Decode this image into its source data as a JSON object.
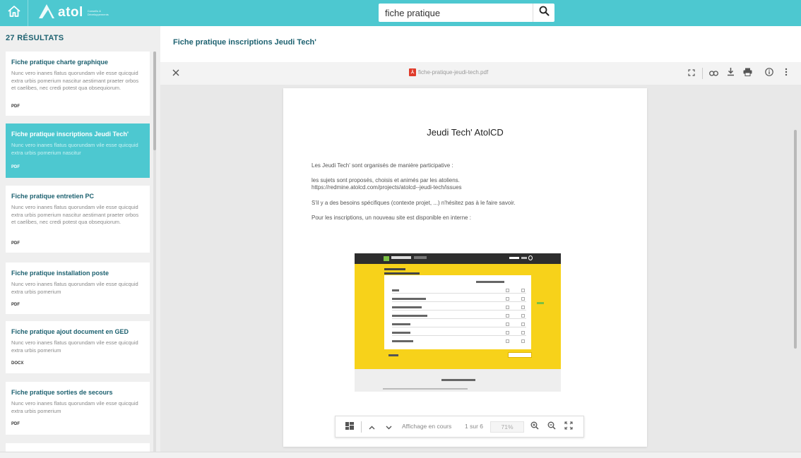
{
  "header": {
    "logo_word": "atol",
    "logo_tagline": "Conseils & Développements",
    "search_value": "fiche pratique",
    "icons": {
      "home": "home-icon",
      "search": "search-icon"
    }
  },
  "results": {
    "count_label": "27 RÉSULTATS",
    "items": [
      {
        "title": "Fiche pratique charte graphique",
        "desc": "Nunc vero inanes flatus quorundam vile esse quicquid extra urbis pomerium nascitur aestimant praeter orbos et caelibes, nec credi potest qua obsequiorum.",
        "type": "PDF",
        "active": false
      },
      {
        "title": "Fiche pratique inscriptions Jeudi Tech'",
        "desc": "Nunc vero inanes flatus quorundam vile esse quicquid extra urbis pomerium nascitur",
        "type": "PDF",
        "active": true
      },
      {
        "title": "Fiche pratique entretien PC",
        "desc": "Nunc vero inanes flatus quorundam vile esse quicquid extra urbis pomerium nascitur aestimant praeter orbos et caelibes, nec credi potest qua obsequiorum.",
        "type": "PDF",
        "active": false
      },
      {
        "title": "Fiche pratique installation poste",
        "desc": "Nunc vero inanes flatus quorundam vile esse quicquid extra urbis pomerium",
        "type": "PDF",
        "active": false
      },
      {
        "title": "Fiche pratique ajout document en GED",
        "desc": "Nunc vero inanes flatus quorundam vile esse quicquid extra urbis pomerium",
        "type": "DOCX",
        "active": false
      },
      {
        "title": "Fiche pratique sorties de secours",
        "desc": "Nunc vero inanes flatus quorundam vile esse quicquid extra urbis pomerium",
        "type": "PDF",
        "active": false
      }
    ]
  },
  "detail": {
    "title": "Fiche pratique inscriptions Jeudi Tech'",
    "file_name": "fiche-pratique-jeudi-tech.pdf",
    "document": {
      "title": "Jeudi Tech' AtolCD",
      "p1": "Les Jeudi Tech' sont organisés de manière participative :",
      "p2a": "les sujets sont proposés, choisis et animés par les atoliens.",
      "p2b": "https://redmine.atolcd.com/projects/atolcd--jeudi-tech/issues",
      "p3": "S'il y a des besoins spécifiques (contexte projet, ...) n'hésitez pas à le faire savoir.",
      "p4": "Pour les inscriptions, un nouveau site est disponible en interne :"
    },
    "pager": {
      "status": "Affichage en cours",
      "page": "1 sur 6",
      "zoom": "71%"
    }
  },
  "colors": {
    "accent": "#4dc8d0",
    "title_text": "#1d6170",
    "pdf_red": "#e03b2b",
    "screenshot_yellow": "#f7d21a"
  }
}
